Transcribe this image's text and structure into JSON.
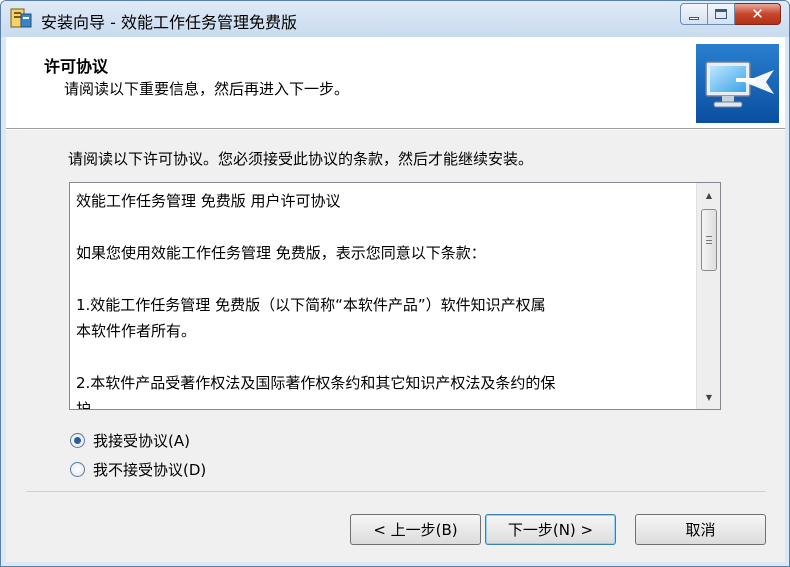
{
  "window": {
    "title": "安装向导 - 效能工作任务管理免费版",
    "minimize_icon": "minimize-icon",
    "maximize_icon": "maximize-icon",
    "close_icon": "close-icon",
    "close_glyph": "✕"
  },
  "header": {
    "title": "许可协议",
    "subtitle": "请阅读以下重要信息，然后再进入下一步。",
    "image_icon": "computer-monitor-icon"
  },
  "instruction": "请阅读以下许可协议。您必须接受此协议的条款，然后才能继续安装。",
  "license": {
    "lines": [
      "效能工作任务管理 免费版 用户许可协议",
      "",
      "如果您使用效能工作任务管理 免费版，表示您同意以下条款：",
      "",
      "1.效能工作任务管理 免费版（以下简称“本软件产品”）软件知识产权属",
      "本软件作者所有。",
      "",
      "2.本软件产品受著作权法及国际著作权条约和其它知识产权法及条约的保",
      "护。"
    ]
  },
  "options": {
    "accept_label": "我接受协议(A)",
    "decline_label": "我不接受协议(D)",
    "selected": "accept"
  },
  "buttons": {
    "back_label": "< 上一步(B)",
    "next_label": "下一步(N) >",
    "cancel_label": "取消"
  },
  "colors": {
    "titlebar": "#c9dbef",
    "close_button": "#c6452c",
    "selected_radio": "#2a5d9c"
  }
}
